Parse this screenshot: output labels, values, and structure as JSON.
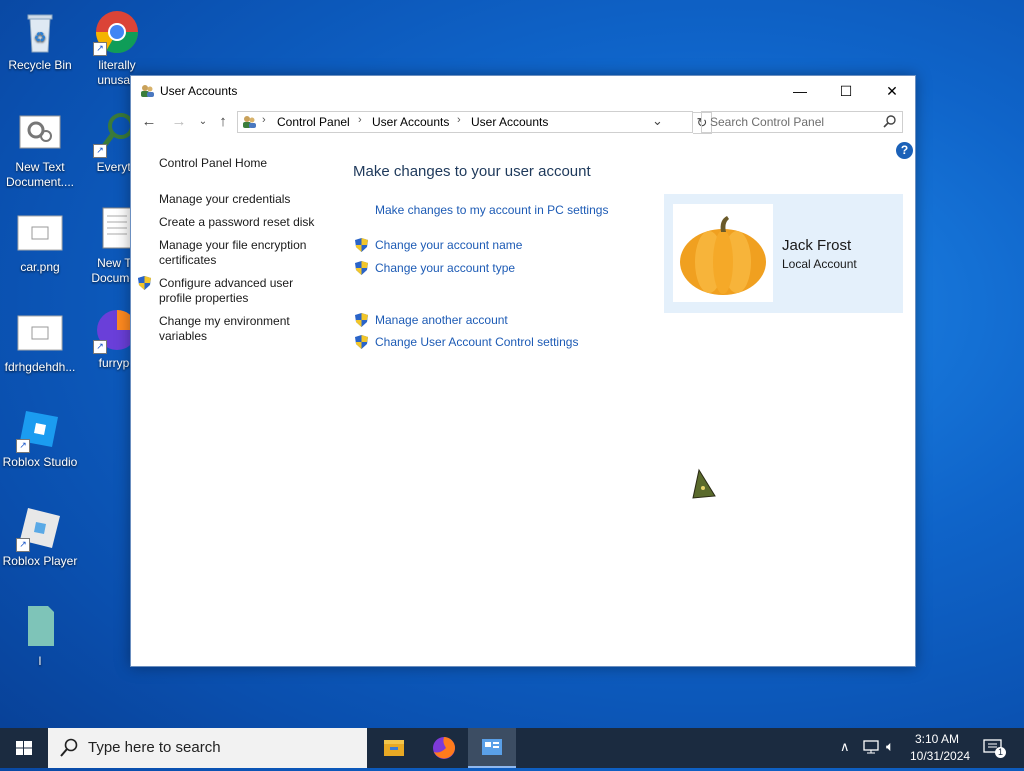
{
  "desktop": {
    "icons": [
      {
        "label": "Recycle Bin"
      },
      {
        "label": "literally unusab"
      },
      {
        "label": "New Text Document...."
      },
      {
        "label": "Everyth"
      },
      {
        "label": "car.png"
      },
      {
        "label": "New Te Documen"
      },
      {
        "label": "fdrhgdehdh..."
      },
      {
        "label": "furrypc"
      },
      {
        "label": "Roblox Studio"
      },
      {
        "label": "Roblox Player"
      },
      {
        "label": "l"
      }
    ]
  },
  "window": {
    "title": "User Accounts",
    "controls": {
      "minimize": "—",
      "maximize": "☐",
      "close": "✕"
    },
    "breadcrumb": [
      "Control Panel",
      "User Accounts",
      "User Accounts"
    ],
    "search_placeholder": "Search Control Panel",
    "help_label": "?"
  },
  "sidebar": {
    "home": "Control Panel Home",
    "links": [
      "Manage your credentials",
      "Create a password reset disk",
      "Manage your file encryption certificates",
      "Configure advanced user profile properties",
      "Change my environment variables"
    ]
  },
  "main": {
    "heading": "Make changes to your user account",
    "pc_settings_link": "Make changes to my account in PC settings",
    "links_group1": [
      "Change your account name",
      "Change your account type"
    ],
    "links_group2": [
      "Manage another account",
      "Change User Account Control settings"
    ]
  },
  "account": {
    "name": "Jack Frost",
    "type": "Local Account"
  },
  "taskbar": {
    "search_placeholder": "Type here to search",
    "time": "3:10 AM",
    "date": "10/31/2024",
    "notification_count": "1"
  },
  "colors": {
    "link": "#1d5bb5",
    "heading": "#1e395b",
    "card_bg": "#e4f0fb",
    "taskbar": "#1b2b40"
  }
}
